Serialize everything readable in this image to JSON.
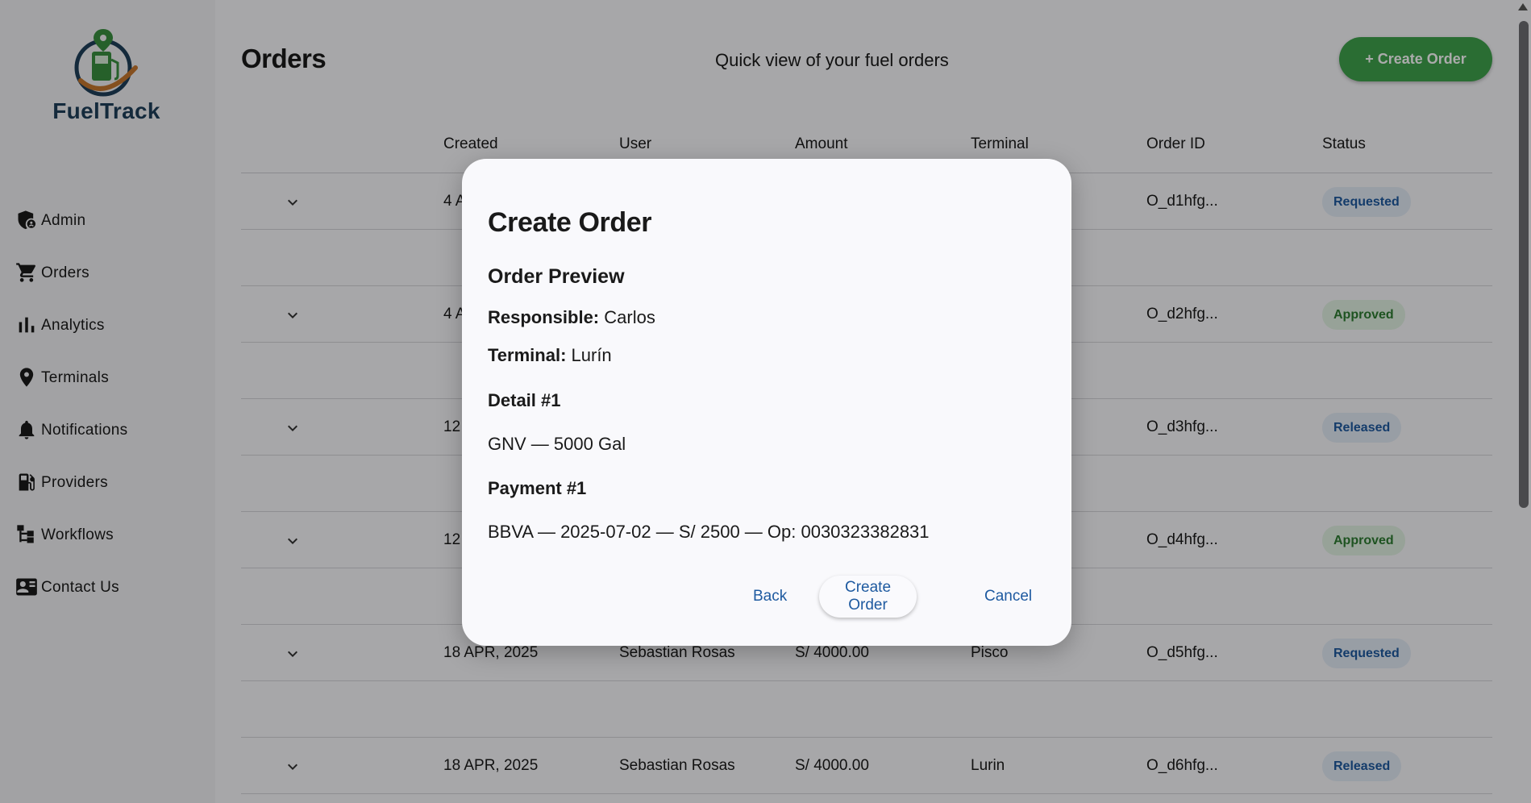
{
  "app": {
    "name": "FuelTrack"
  },
  "sidebar": {
    "items": [
      {
        "label": "Admin",
        "icon": "admin-shield-icon"
      },
      {
        "label": "Orders",
        "icon": "cart-icon"
      },
      {
        "label": "Analytics",
        "icon": "bar-chart-icon"
      },
      {
        "label": "Terminals",
        "icon": "location-pin-icon"
      },
      {
        "label": "Notifications",
        "icon": "bell-icon"
      },
      {
        "label": "Providers",
        "icon": "fuel-station-icon"
      },
      {
        "label": "Workflows",
        "icon": "workflow-icon"
      },
      {
        "label": "Contact Us",
        "icon": "contact-card-icon"
      }
    ]
  },
  "header": {
    "title": "Orders",
    "subtitle": "Quick view of your fuel orders",
    "create_button": "+ Create Order"
  },
  "table": {
    "columns": [
      "Created",
      "User",
      "Amount",
      "Terminal",
      "Order ID",
      "Status"
    ],
    "rows": [
      {
        "created": "4 A",
        "user": "",
        "amount": "",
        "terminal": "",
        "order_id": "O_d1hfg...",
        "status": "Requested"
      },
      {
        "created": "4 A",
        "user": "",
        "amount": "",
        "terminal": "",
        "order_id": "O_d2hfg...",
        "status": "Approved"
      },
      {
        "created": "12",
        "user": "",
        "amount": "",
        "terminal": "",
        "order_id": "O_d3hfg...",
        "status": "Released"
      },
      {
        "created": "12",
        "user": "",
        "amount": "",
        "terminal": "",
        "order_id": "O_d4hfg...",
        "status": "Approved"
      },
      {
        "created": "18 APR, 2025",
        "user": "Sebastian Rosas",
        "amount": "S/ 4000.00",
        "terminal": "Pisco",
        "order_id": "O_d5hfg...",
        "status": "Requested"
      },
      {
        "created": "18 APR, 2025",
        "user": "Sebastian Rosas",
        "amount": "S/ 4000.00",
        "terminal": "Lurin",
        "order_id": "O_d6hfg...",
        "status": "Released"
      }
    ]
  },
  "modal": {
    "title": "Create Order",
    "subtitle": "Order Preview",
    "responsible_label": "Responsible:",
    "responsible_value": "Carlos",
    "terminal_label": "Terminal:",
    "terminal_value": "Lurín",
    "detail_heading": "Detail #1",
    "detail_value": "GNV — 5000 Gal",
    "payment_heading": "Payment #1",
    "payment_value": "BBVA — 2025-07-02 — S/ 2500 — Op: 0030323382831",
    "back_label": "Back",
    "create_label": "Create Order",
    "cancel_label": "Cancel"
  },
  "colors": {
    "accent": "#3fa34d",
    "link": "#1e5aa0",
    "logo_text": "#1e3f5a"
  }
}
